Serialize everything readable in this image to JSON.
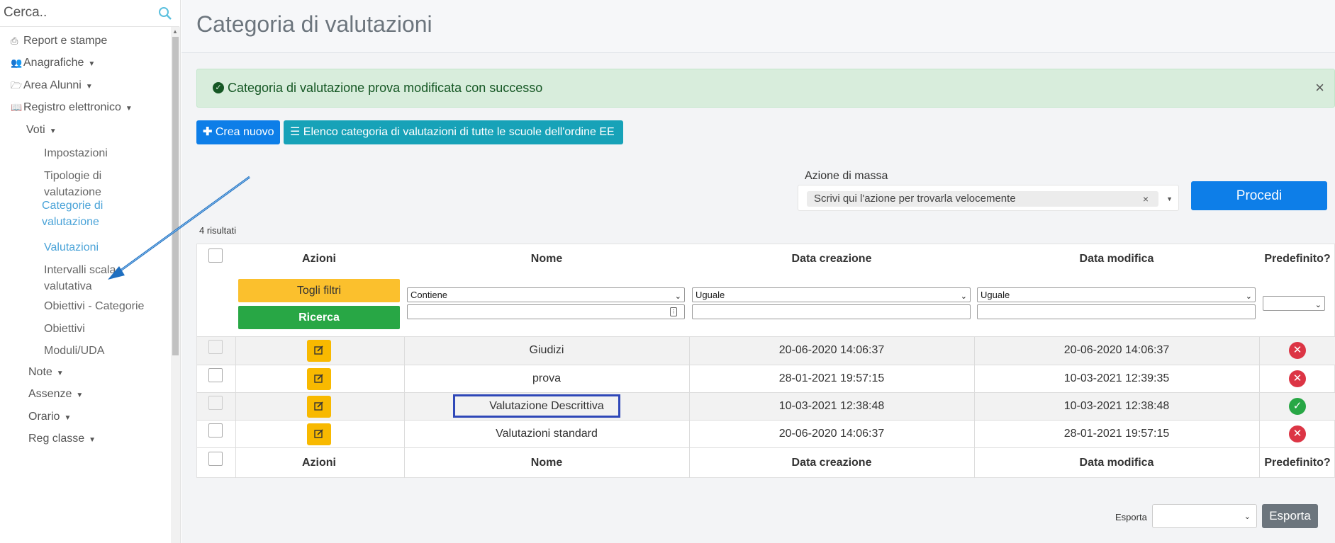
{
  "sidebar": {
    "search_placeholder": "Cerca..",
    "items": [
      {
        "label": "Report e stampe",
        "icon": "print-icon"
      },
      {
        "label": "Anagrafiche",
        "icon": "users-icon"
      },
      {
        "label": "Area Alunni",
        "icon": "folder-open-icon"
      },
      {
        "label": "Registro elettronico",
        "icon": "book-icon"
      },
      {
        "label": "Voti"
      },
      {
        "label": "Impostazioni"
      },
      {
        "label_line1": "Tipologie di",
        "label_line2": "valutazione"
      },
      {
        "label_line1": "Categorie di",
        "label_line2": "valutazione"
      },
      {
        "label": "Valutazioni"
      },
      {
        "label_line1": "Intervalli scala",
        "label_line2": "valutativa"
      },
      {
        "label": "Obiettivi - Categorie"
      },
      {
        "label": "Obiettivi"
      },
      {
        "label": "Moduli/UDA"
      },
      {
        "label": "Note"
      },
      {
        "label": "Assenze"
      },
      {
        "label": "Orario"
      },
      {
        "label": "Reg classe"
      }
    ]
  },
  "page": {
    "title": "Categoria di valutazioni"
  },
  "alert": {
    "text": "Categoria di valutazione prova modificata con successo",
    "close": "×"
  },
  "toolbar": {
    "new_label": "Crea nuovo",
    "list_label": "Elenco categoria di valutazioni di tutte le scuole dell'ordine EE"
  },
  "mass_action": {
    "label": "Azione di massa",
    "placeholder": "Scrivi qui l'azione per trovarla velocemente",
    "clear": "×",
    "submit_label": "Procedi"
  },
  "results_count": "4 risultati",
  "table": {
    "headers": {
      "actions": "Azioni",
      "name": "Nome",
      "created": "Data creazione",
      "modified": "Data modifica",
      "default": "Predefinito?"
    },
    "filters": {
      "clear_label": "Togli filtri",
      "search_label": "Ricerca",
      "name_op": "Contiene",
      "created_op": "Uguale",
      "modified_op": "Uguale"
    },
    "rows": [
      {
        "name": "Giudizi",
        "created": "20-06-2020 14:06:37",
        "modified": "20-06-2020 14:06:37",
        "default": false
      },
      {
        "name": "prova",
        "created": "28-01-2021 19:57:15",
        "modified": "10-03-2021 12:39:35",
        "default": false
      },
      {
        "name": "Valutazione Descrittiva",
        "created": "10-03-2021 12:38:48",
        "modified": "10-03-2021 12:38:48",
        "default": true
      },
      {
        "name": "Valutazioni standard",
        "created": "20-06-2020 14:06:37",
        "modified": "28-01-2021 19:57:15",
        "default": false
      }
    ],
    "status_icons": {
      "yes": "✓",
      "no": "✕"
    }
  },
  "export": {
    "label": "Esporta",
    "button_label": "Esporta"
  },
  "colors": {
    "primary": "#0d7ee8",
    "info": "#17a2b8",
    "warning": "#fbc02d",
    "success": "#28a745",
    "danger": "#dc3545",
    "highlight": "#2f48b8"
  }
}
